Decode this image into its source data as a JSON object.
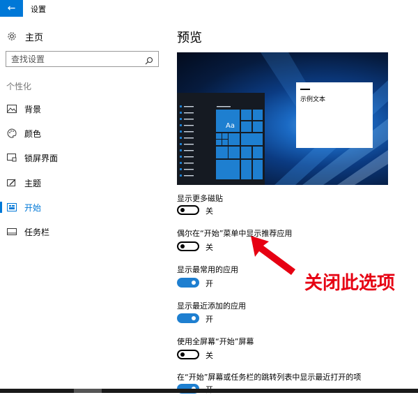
{
  "window": {
    "title": "设置"
  },
  "sidebar": {
    "home_label": "主页",
    "search_placeholder": "查找设置",
    "section_title": "个性化",
    "items": [
      {
        "label": "背景",
        "icon": "picture-icon",
        "active": false
      },
      {
        "label": "颜色",
        "icon": "palette-icon",
        "active": false
      },
      {
        "label": "锁屏界面",
        "icon": "lockscreen-icon",
        "active": false
      },
      {
        "label": "主题",
        "icon": "theme-icon",
        "active": false
      },
      {
        "label": "开始",
        "icon": "start-icon",
        "active": true
      },
      {
        "label": "任务栏",
        "icon": "taskbar-icon",
        "active": false
      }
    ]
  },
  "main": {
    "title": "预览",
    "preview": {
      "tile_label": "Aa",
      "sample_text": "示例文本"
    },
    "settings": [
      {
        "label": "显示更多磁贴",
        "state": "关",
        "on": false
      },
      {
        "label": "偶尔在“开始”菜单中显示推荐应用",
        "state": "关",
        "on": false
      },
      {
        "label": "显示最常用的应用",
        "state": "开",
        "on": true
      },
      {
        "label": "显示最近添加的应用",
        "state": "开",
        "on": true
      },
      {
        "label": "使用全屏幕“开始”屏幕",
        "state": "关",
        "on": false
      },
      {
        "label": "在“开始”屏幕或任务栏的跳转列表中显示最近打开的项",
        "state": "开",
        "on": true
      }
    ]
  },
  "annotation": {
    "text": "关闭此选项",
    "color": "#e60012"
  },
  "colors": {
    "accent": "#0078d7",
    "toggle_on": "#1e7fd0"
  }
}
